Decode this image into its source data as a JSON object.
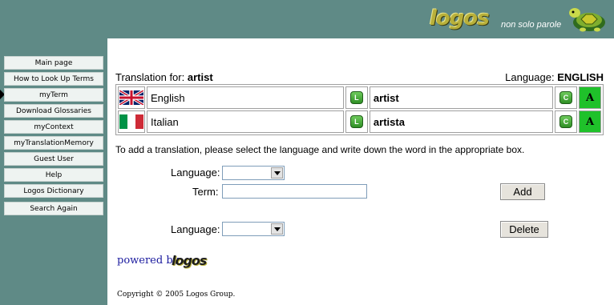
{
  "header": {
    "logo_text": "logos",
    "slogan": "non solo parole"
  },
  "sidebar": {
    "items": [
      {
        "label": "Main page"
      },
      {
        "label": "How to Look Up Terms"
      },
      {
        "label": "myTerm"
      },
      {
        "label": "Download Glossaries"
      },
      {
        "label": "myContext"
      },
      {
        "label": "myTranslationMemory"
      },
      {
        "label": "Guest User"
      },
      {
        "label": "Help"
      },
      {
        "label": "Logos Dictionary"
      },
      {
        "label": "Search Again"
      }
    ],
    "active": "myTerm"
  },
  "translation": {
    "prefix": "Translation for:",
    "term": "artist",
    "language_prefix": "Language:",
    "language": "ENGLISH",
    "rows": [
      {
        "flag": "uk-flag-icon",
        "language": "English",
        "word": "artist",
        "l_icon": "L",
        "c_icon": "C",
        "a_icon": "A"
      },
      {
        "flag": "italy-flag-icon",
        "language": "Italian",
        "word": "artista",
        "l_icon": "L",
        "c_icon": "C",
        "a_icon": "A"
      }
    ]
  },
  "form": {
    "instruction": "To add a translation, please select the language and write down the word in the appropriate box.",
    "language_label": "Language:",
    "term_label": "Term:",
    "term_value": "",
    "add_label": "Add",
    "delete_label": "Delete"
  },
  "footer": {
    "powered_by": "powered by",
    "powered_logo": "logos",
    "copyright": "Copyright © 2005 Logos Group."
  },
  "colors": {
    "background": "#5f8a86",
    "a_cell": "#1fc12a",
    "logo": "#b8b03a"
  }
}
